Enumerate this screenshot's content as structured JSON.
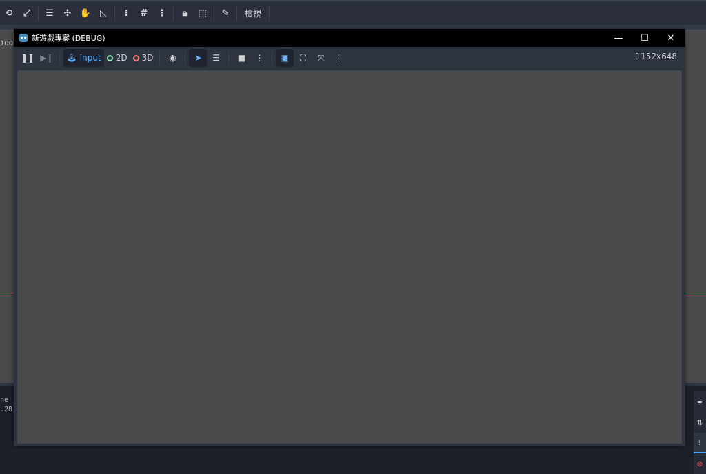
{
  "editor": {
    "toolbar_view_label": "檢視",
    "ruler_left_label": "100",
    "console_lines": [
      "ne",
      ".28"
    ],
    "accent_color": "#478cbf",
    "axis_color": "#c74a5a"
  },
  "debug_window": {
    "title": "新遊戲專案 (DEBUG)",
    "controls": {
      "minimize": "—",
      "maximize": "☐",
      "close": "✕"
    },
    "toolbar": {
      "input_label": "Input",
      "mode_2d_label": "2D",
      "mode_3d_label": "3D",
      "resolution": "1152x648"
    },
    "viewport_color": "#4a4a4a"
  }
}
